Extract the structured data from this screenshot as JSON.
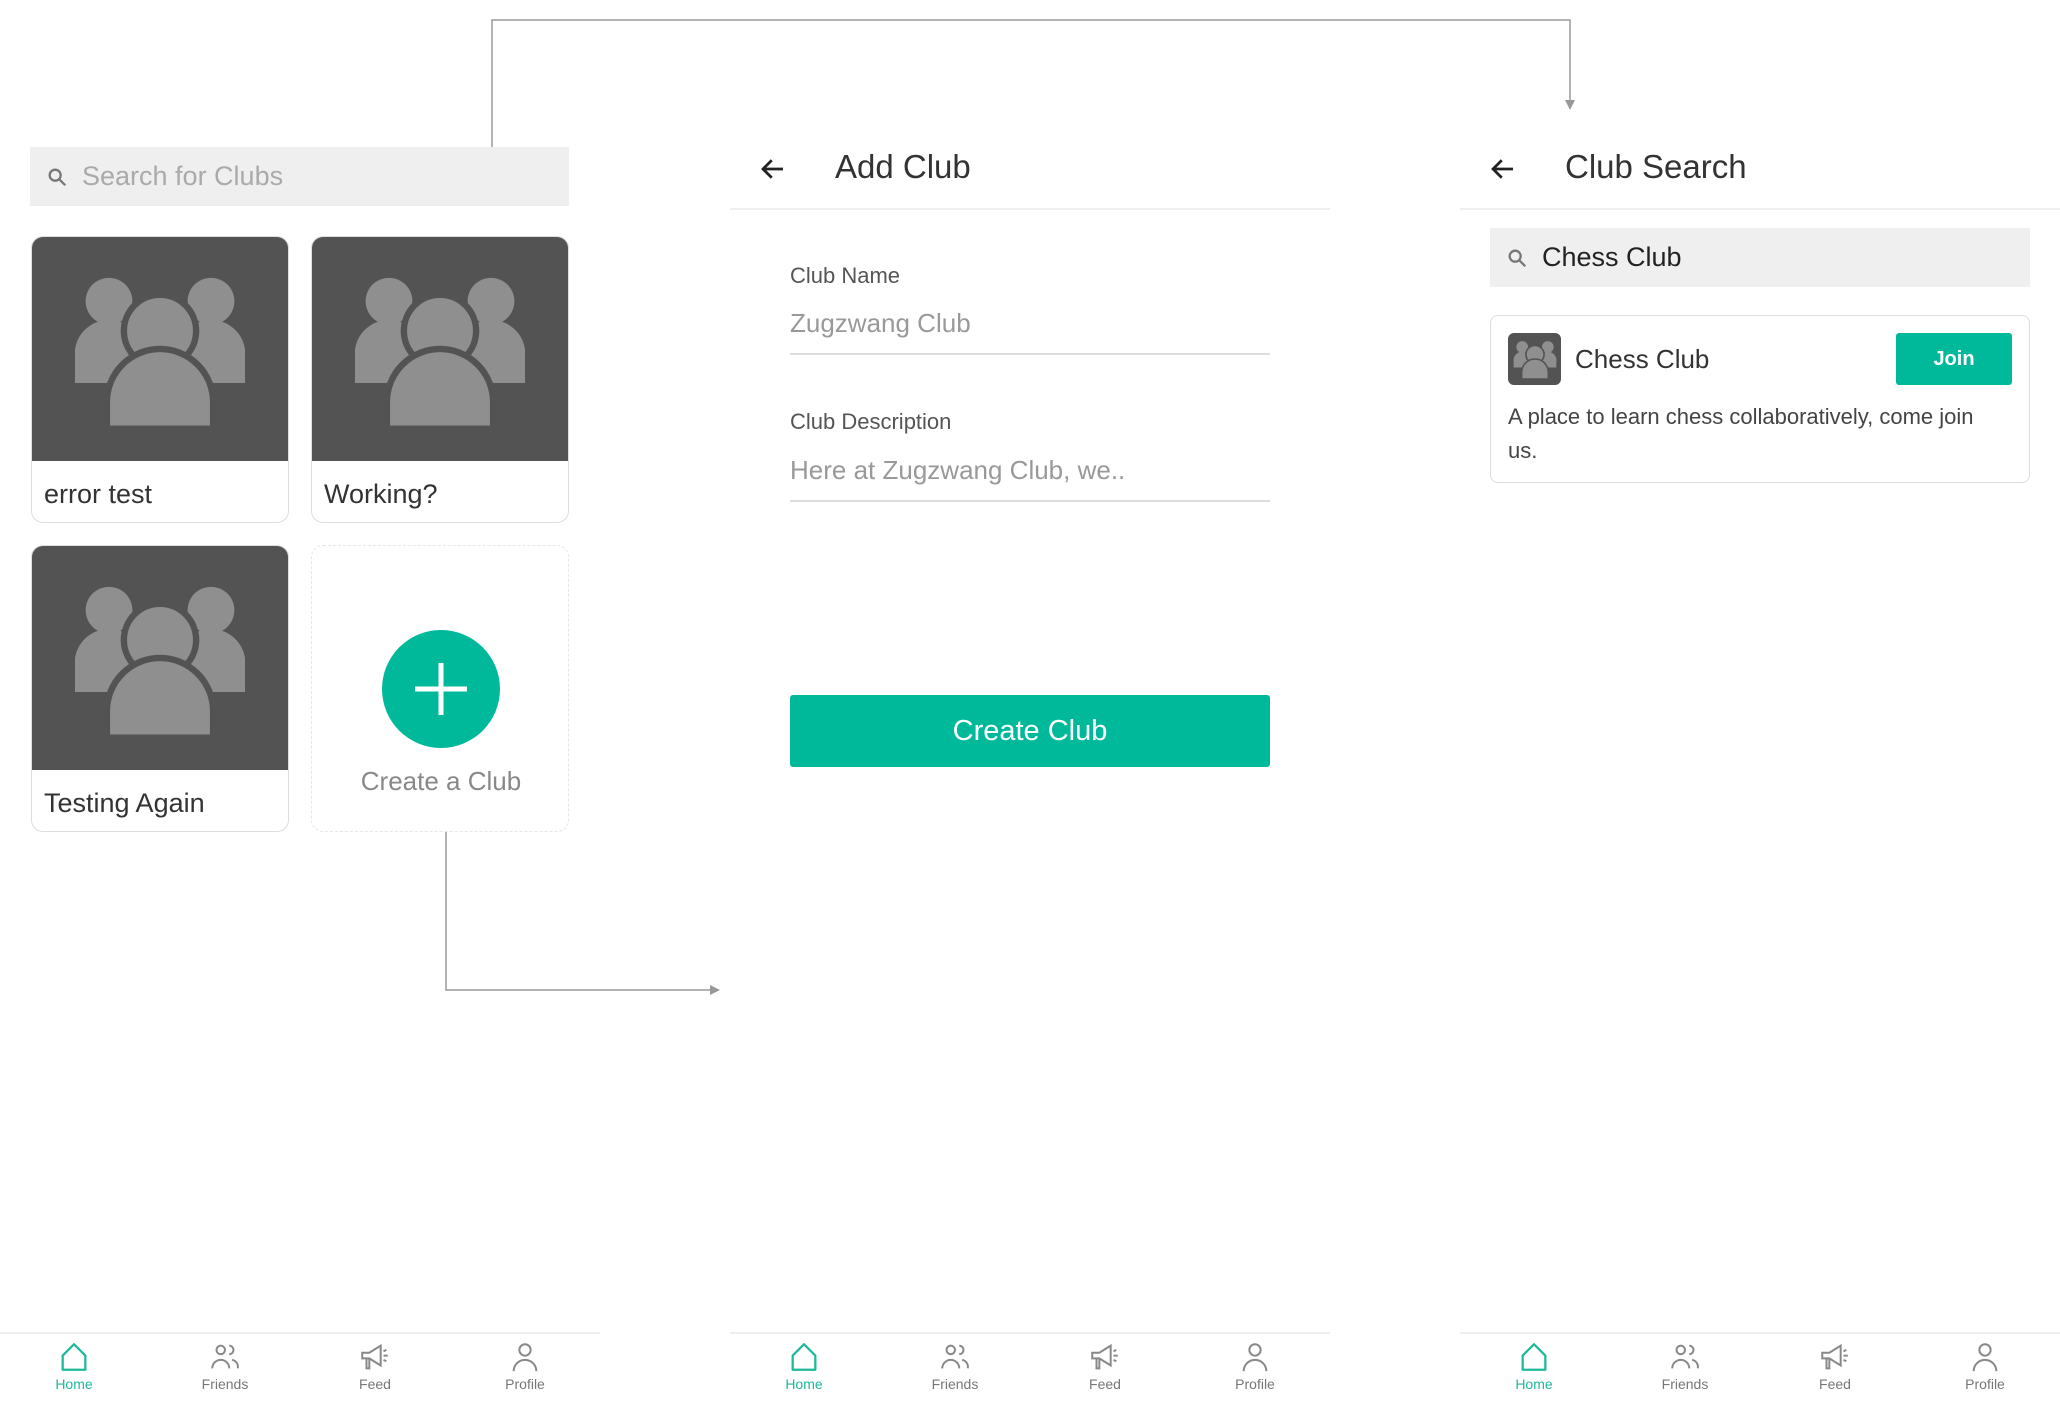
{
  "colors": {
    "accent": "#00b99b",
    "card_image": "#535353",
    "placeholder_icon": "#8f8f8f"
  },
  "home": {
    "search_placeholder": "Search for Clubs",
    "clubs": [
      {
        "name": "error test"
      },
      {
        "name": "Working?"
      },
      {
        "name": "Testing Again"
      }
    ],
    "create_label": "Create a Club"
  },
  "add_club": {
    "title": "Add Club",
    "name_label": "Club Name",
    "name_placeholder": "Zugzwang Club",
    "desc_label": "Club Description",
    "desc_placeholder": "Here at Zugzwang Club, we..",
    "create_button": "Create Club"
  },
  "club_search": {
    "title": "Club Search",
    "search_value": "Chess Club",
    "result": {
      "name": "Chess Club",
      "join": "Join",
      "description": "A place to learn chess collaboratively, come join us."
    }
  },
  "nav": {
    "items": [
      {
        "label": "Home",
        "icon": "home-icon"
      },
      {
        "label": "Friends",
        "icon": "friends-icon"
      },
      {
        "label": "Feed",
        "icon": "megaphone-icon"
      },
      {
        "label": "Profile",
        "icon": "profile-icon"
      }
    ],
    "active": "Home"
  }
}
